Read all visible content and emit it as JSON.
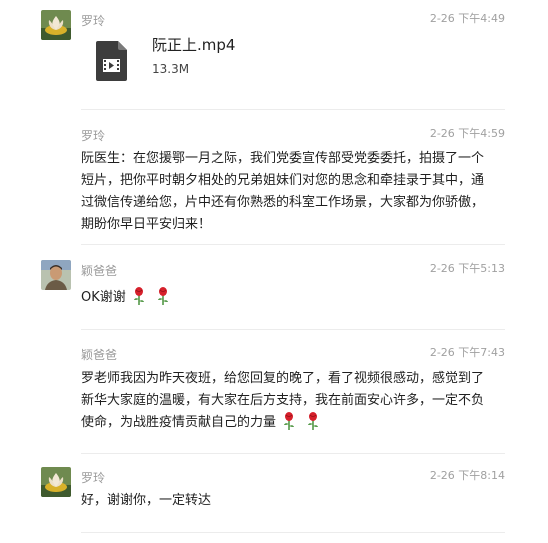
{
  "messages": [
    {
      "sender": "罗玲",
      "time": "2-26 下午4:49",
      "avatar_icon": "lotus-avatar",
      "file": {
        "name": "阮正上.mp4",
        "size": "13.3M",
        "icon": "video-file-icon"
      }
    },
    {
      "sender": "罗玲",
      "time": "2-26 下午4:59",
      "text": "阮医生：在您援鄂一月之际，我们党委宣传部受党委委托，拍摄了一个短片，把你平时朝夕相处的兄弟姐妹们对您的思念和牵挂录于其中，通过微信传递给您，片中还有你熟悉的科室工作场景，大家都为你骄傲，期盼你早日平安归来！"
    },
    {
      "sender": "颖爸爸",
      "time": "2-26 下午5:13",
      "avatar_icon": "man-avatar",
      "text": "OK谢谢",
      "emoji": [
        "rose-icon",
        "rose-icon"
      ]
    },
    {
      "sender": "颖爸爸",
      "time": "2-26 下午7:43",
      "text": "罗老师我因为昨天夜班，给您回复的晚了，看了视频很感动，感觉到了新华大家庭的温暖，有大家在后方支持，我在前面安心许多，一定不负使命，为战胜疫情贡献自己的力量",
      "emoji": [
        "rose-icon",
        "rose-icon"
      ]
    },
    {
      "sender": "罗玲",
      "time": "2-26 下午8:14",
      "avatar_icon": "lotus-avatar",
      "text": "好，谢谢你，一定转达"
    }
  ],
  "colors": {
    "sender": "#9a9a9a",
    "time": "#a0a0a0",
    "divider": "#ececec",
    "rose": "#d6202b",
    "stem": "#3c8a2e"
  }
}
